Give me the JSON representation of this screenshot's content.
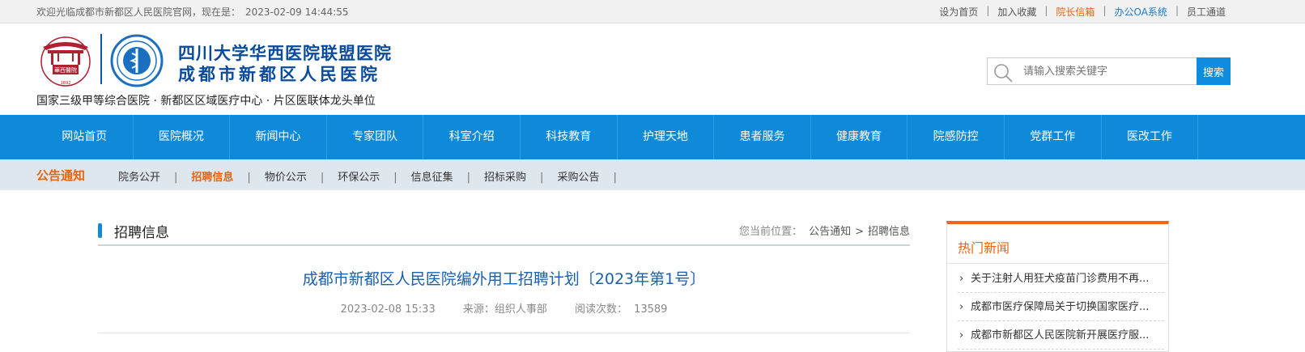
{
  "topbar": {
    "welcome": "欢迎光临成都市新都区人民医院官网，现在是：",
    "datetime": "2023-02-09 14:44:55",
    "links": [
      {
        "label": "设为首页",
        "color": "#555555"
      },
      {
        "label": "加入收藏",
        "color": "#555555"
      },
      {
        "label": "院长信箱",
        "color": "#e86410"
      },
      {
        "label": "办公OA系统",
        "color": "#1a7ad0"
      },
      {
        "label": "员工通道",
        "color": "#555555"
      }
    ]
  },
  "header": {
    "emblem_left_text": "華西醫院",
    "emblem_left_year": "1892",
    "title_line1": "四川大学华西医院联盟医院",
    "title_line2": "成都市新都区人民医院",
    "slogan": "国家三级甲等综合医院 · 新都区区域医疗中心 · 片区医联体龙头单位"
  },
  "search": {
    "placeholder": "请输入搜索关键字",
    "button_label": "搜索"
  },
  "nav": {
    "items": [
      "网站首页",
      "医院概况",
      "新闻中心",
      "专家团队",
      "科室介绍",
      "科技教育",
      "护理天地",
      "患者服务",
      "健康教育",
      "院感防控",
      "党群工作",
      "医改工作"
    ]
  },
  "subnav": {
    "category": "公告通知",
    "items": [
      {
        "label": "院务公开",
        "active": false
      },
      {
        "label": "招聘信息",
        "active": true
      },
      {
        "label": "物价公示",
        "active": false
      },
      {
        "label": "环保公示",
        "active": false
      },
      {
        "label": "信息征集",
        "active": false
      },
      {
        "label": "招标采购",
        "active": false
      },
      {
        "label": "采购公告",
        "active": false
      }
    ]
  },
  "main": {
    "section_title": "招聘信息",
    "breadcrumb": {
      "label": "您当前位置：",
      "parent": "公告通知",
      "separator": ">",
      "current": "招聘信息"
    },
    "article": {
      "title": "成都市新都区人民医院编外用工招聘计划〔2023年第1号〕",
      "date": "2023-02-08 15:33",
      "source": "来源：组织人事部",
      "views_label": "阅读次数：",
      "views": "13589"
    }
  },
  "sidebar": {
    "title": "热门新闻",
    "items": [
      "关于注射人用狂犬疫苗门诊费用不再...",
      "成都市医疗保障局关于切换国家医疗...",
      "成都市新都区人民医院新开展医疗服..."
    ]
  },
  "colors": {
    "primary_blue": "#0f8ad8",
    "accent_orange": "#e86410",
    "title_blue": "#0a4a9a"
  }
}
